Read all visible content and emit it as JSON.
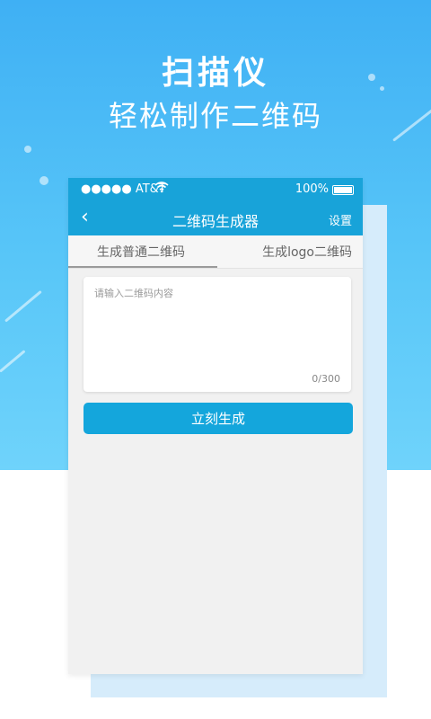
{
  "hero": {
    "title": "扫描仪",
    "subtitle": "轻松制作二维码"
  },
  "status_bar": {
    "carrier": "●●●●● AT&T",
    "wifi_icon": "wifi-icon",
    "battery": "100%"
  },
  "nav": {
    "back_icon": "‹",
    "title": "二维码生成器",
    "settings": "设置"
  },
  "tabs": [
    {
      "label": "生成普通二维码",
      "active": true
    },
    {
      "label": "生成logo二维码",
      "active": false
    }
  ],
  "input": {
    "placeholder": "请输入二维码内容",
    "value": "",
    "counter": "0/300"
  },
  "generate_button": {
    "label": "立刻生成"
  },
  "colors": {
    "accent": "#18a3d9",
    "hero_top": "#3fb0f4",
    "hero_bottom": "#6fd3fb"
  }
}
